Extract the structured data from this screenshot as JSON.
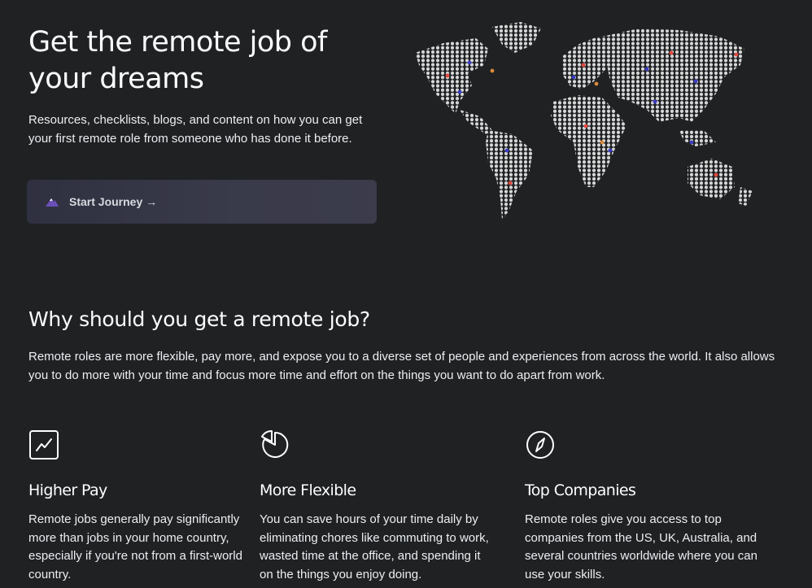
{
  "hero": {
    "title": "Get the remote job of your dreams",
    "subtitle": "Resources, checklists, blogs, and content on how you can get your first remote role from someone who has done it before.",
    "cta_label": "Start Journey →",
    "cta_icon": "mountain-icon",
    "map_icon": "world-map"
  },
  "why": {
    "title": "Why should you get a remote job?",
    "body": "Remote roles are more flexible, pay more, and expose you to a diverse set of people and experiences from across the world. It also allows you to do more with your time and focus more time and effort on the things you want to do apart from work."
  },
  "features": [
    {
      "icon": "trending-chart-icon",
      "title": "Higher Pay",
      "text": "Remote jobs generally pay significantly more than jobs in your home country, especially if you're not from a first-world country."
    },
    {
      "icon": "pie-chart-icon",
      "title": "More Flexible",
      "text": "You can save hours of your time daily by eliminating chores like commuting to work, wasted time at the office, and spending it on the things you enjoy doing."
    },
    {
      "icon": "compass-icon",
      "title": "Top Companies",
      "text": "Remote roles give you access to top companies from the US, UK, Australia, and several countries worldwide where you can use your skills."
    }
  ],
  "colors": {
    "background": "#1f2123",
    "accent_purple": "#3b3cc4",
    "accent_red": "#e2483f",
    "accent_orange": "#d98a3a"
  }
}
